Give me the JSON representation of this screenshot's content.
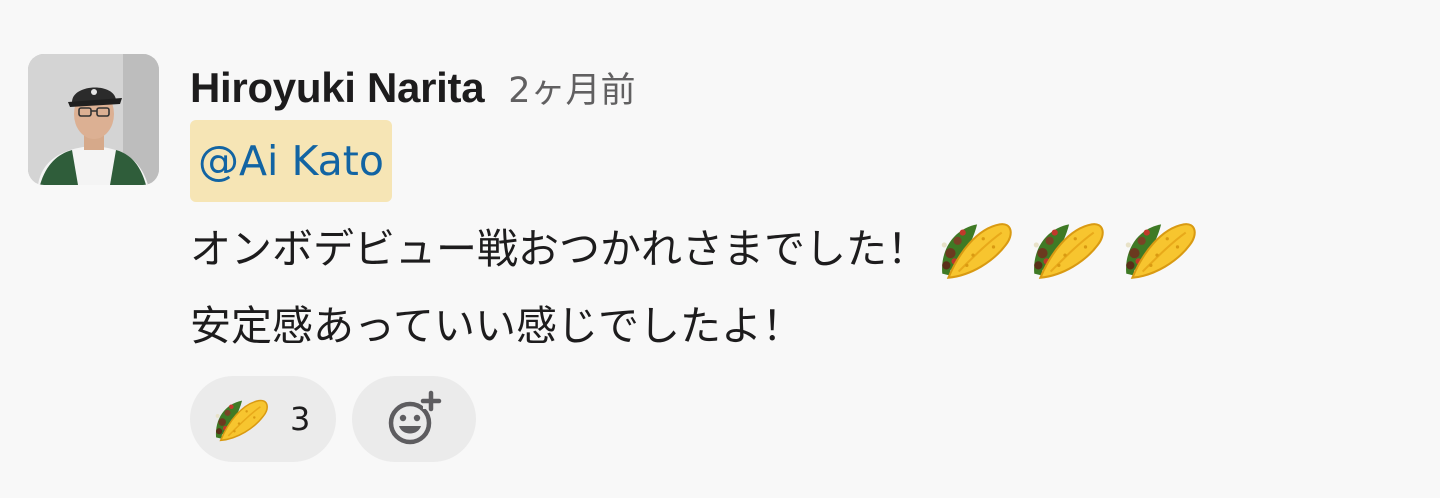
{
  "message": {
    "sender": "Hiroyuki Narita",
    "timestamp": "2ヶ月前",
    "mention": "@Ai Kato",
    "line1": "オンボデビュー戦おつかれさまでした！",
    "line1_emojis": [
      "taco",
      "taco",
      "taco"
    ],
    "line2": "安定感あっていい感じでしたよ！"
  },
  "reactions": [
    {
      "emoji": "taco",
      "count": "3"
    }
  ],
  "icons": {
    "add_reaction": "add-reaction-icon"
  },
  "colors": {
    "background": "#f8f8f8",
    "mention_bg": "#f6e5b5",
    "mention_text": "#1264a3",
    "text": "#1d1c1d",
    "muted": "#616061",
    "reaction_bg": "#ebebeb"
  }
}
